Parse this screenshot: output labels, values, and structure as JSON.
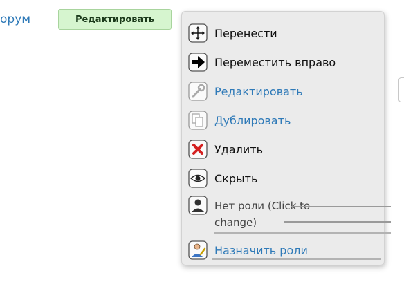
{
  "header": {
    "forum_link": "орум",
    "edit_button": "Редактировать"
  },
  "menu": {
    "items": [
      {
        "label": "Перенести",
        "icon": "move-icon"
      },
      {
        "label": "Переместить вправо",
        "icon": "arrow-right-icon"
      },
      {
        "label": "Редактировать",
        "icon": "wrench-icon"
      },
      {
        "label": "Дублировать",
        "icon": "duplicate-icon"
      },
      {
        "label": "Удалить",
        "icon": "delete-icon"
      },
      {
        "label": "Скрыть",
        "icon": "eye-icon"
      },
      {
        "label": "Нет роли (Click to change)",
        "icon": "user-icon"
      },
      {
        "label": "Назначить роли",
        "icon": "assign-roles-icon"
      }
    ]
  }
}
